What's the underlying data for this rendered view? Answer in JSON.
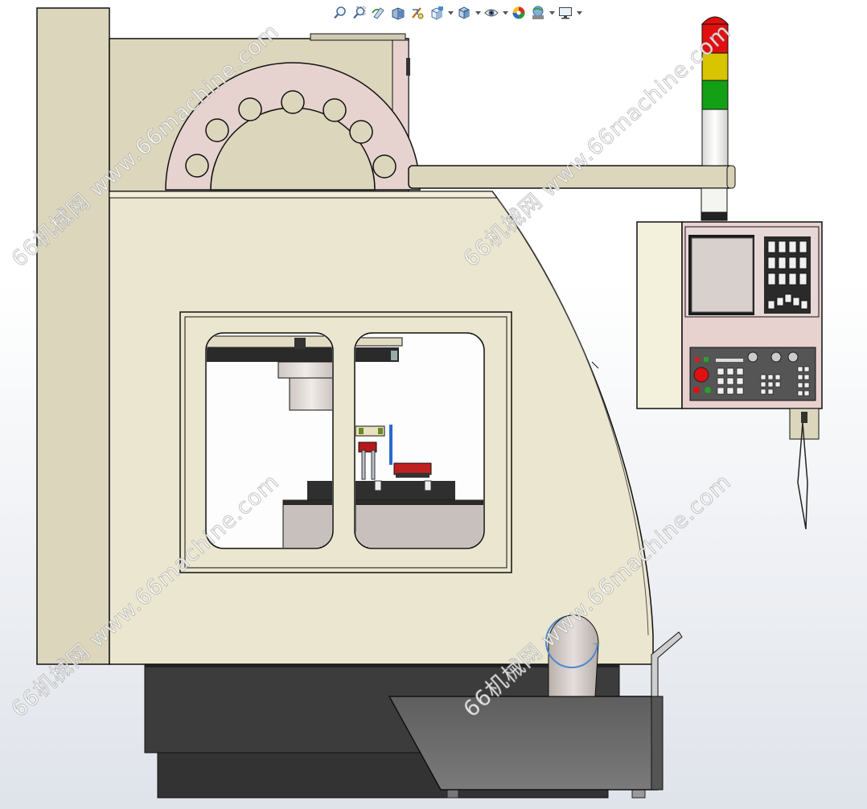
{
  "toolbar": {
    "buttons": [
      {
        "icon": "zoom-to-fit-icon"
      },
      {
        "icon": "zoom-to-area-icon"
      },
      {
        "icon": "previous-view-icon"
      },
      {
        "icon": "section-view-icon"
      },
      {
        "icon": "dynamic-annotation-icon"
      },
      {
        "icon": "view-orientation-icon",
        "dropdown": true
      },
      {
        "icon": "display-style-icon",
        "dropdown": true
      },
      {
        "icon": "hide-show-items-icon",
        "dropdown": true
      },
      {
        "icon": "edit-appearance-icon"
      },
      {
        "icon": "apply-scene-icon",
        "dropdown": true
      },
      {
        "icon": "view-settings-icon",
        "dropdown": true
      }
    ]
  },
  "watermark": {
    "text": "66机械网 www.66machine.com"
  },
  "colors": {
    "body": "#dcd6bd",
    "body_light": "#ebe6cf",
    "pink_panel": "#e8d2d0",
    "base_dark": "#3a3a3a",
    "tray": "#6a6a6a",
    "lamp_red": "#e01010",
    "lamp_yellow": "#d8c400",
    "lamp_green": "#14a014",
    "lamp_white": "#f4f4f0",
    "screen": "#d8d0cc"
  }
}
